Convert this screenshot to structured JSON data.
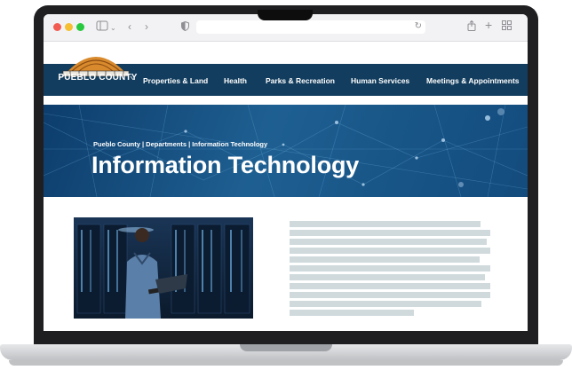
{
  "browser": {
    "address_text": ""
  },
  "site": {
    "logo_text": "PUEBLO COUNTY",
    "nav": [
      "Properties & Land",
      "Health",
      "Parks & Recreation",
      "Human Services",
      "Meetings & Appointments"
    ]
  },
  "hero": {
    "breadcrumb": "Pueblo County | Departments | Information Technology",
    "title": "Information Technology"
  },
  "colors": {
    "nav_bg": "#123d5e",
    "hero_bg": "#1e5f91",
    "placeholder_text": "#d0dadd"
  },
  "icons": [
    "sidebar-icon",
    "chevron-left-icon",
    "chevron-right-icon",
    "shield-icon",
    "reload-icon",
    "share-icon",
    "plus-icon",
    "tabs-grid-icon"
  ]
}
